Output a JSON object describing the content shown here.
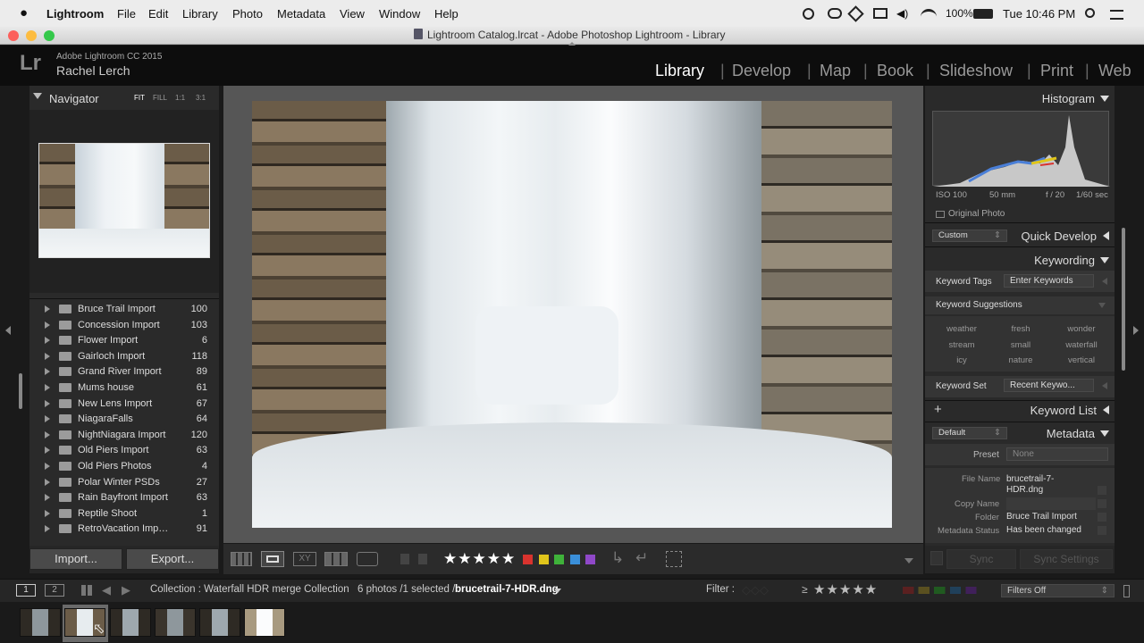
{
  "menubar": {
    "apple": "",
    "app": "Lightroom",
    "items": [
      "File",
      "Edit",
      "Library",
      "Photo",
      "Metadata",
      "View",
      "Window",
      "Help"
    ],
    "battery": "100%",
    "clock": "Tue 10:46 PM"
  },
  "window": {
    "title": "Lightroom Catalog.lrcat - Adobe Photoshop Lightroom - Library"
  },
  "identity": {
    "logo": "Lr",
    "product": "Adobe Lightroom CC 2015",
    "user": "Rachel Lerch"
  },
  "modules": [
    "Library",
    "Develop",
    "Map",
    "Book",
    "Slideshow",
    "Print",
    "Web"
  ],
  "active_module": "Library",
  "navigator": {
    "title": "Navigator",
    "zoom": [
      "FIT",
      "FILL",
      "1:1",
      "3:1"
    ]
  },
  "folders": [
    {
      "name": "Bruce Trail Import",
      "count": "100"
    },
    {
      "name": "Concession Import",
      "count": "103"
    },
    {
      "name": "Flower Import",
      "count": "6"
    },
    {
      "name": "Gairloch Import",
      "count": "118"
    },
    {
      "name": "Grand River Import",
      "count": "89"
    },
    {
      "name": "Mums house",
      "count": "61"
    },
    {
      "name": "New Lens Import",
      "count": "67"
    },
    {
      "name": "NiagaraFalls",
      "count": "64"
    },
    {
      "name": "NightNiagara Import",
      "count": "120"
    },
    {
      "name": "Old Piers Import",
      "count": "63"
    },
    {
      "name": "Old Piers Photos",
      "count": "4"
    },
    {
      "name": "Polar Winter PSDs",
      "count": "27"
    },
    {
      "name": "Rain Bayfront Import",
      "count": "63"
    },
    {
      "name": "Reptile Shoot",
      "count": "1"
    },
    {
      "name": "RetroVacation Imp…",
      "count": "91"
    }
  ],
  "left_buttons": {
    "import": "Import...",
    "export": "Export..."
  },
  "histogram": {
    "title": "Histogram",
    "iso": "ISO 100",
    "focal": "50 mm",
    "aperture": "f / 20",
    "shutter": "1/60 sec",
    "original_photo": "Original Photo"
  },
  "quick_develop": {
    "title": "Quick Develop",
    "preset": "Custom"
  },
  "keywording": {
    "title": "Keywording",
    "tags_label": "Keyword Tags",
    "tags_value": "Enter Keywords",
    "suggestions_label": "Keyword Suggestions",
    "suggestions": [
      "weather",
      "fresh",
      "wonder",
      "stream",
      "small",
      "waterfall",
      "icy",
      "nature",
      "vertical"
    ],
    "set_label": "Keyword Set",
    "set_value": "Recent Keywo..."
  },
  "keyword_list": {
    "title": "Keyword List",
    "add": "+"
  },
  "metadata": {
    "title": "Metadata",
    "view": "Default",
    "preset_label": "Preset",
    "preset_value": "None",
    "file_name_label": "File Name",
    "file_name_line1": "brucetrail-7-",
    "file_name_line2": "HDR.dng",
    "copy_name_label": "Copy Name",
    "folder_label": "Folder",
    "folder_value": "Bruce Trail Import",
    "status_label": "Metadata Status",
    "status_value": "Has been changed"
  },
  "sync": {
    "sync": "Sync",
    "sync_settings": "Sync Settings"
  },
  "toolbar": {
    "stars": "★★★★★",
    "xy": "XY"
  },
  "label_colors": [
    "#d9332e",
    "#e0c51b",
    "#3fb23a",
    "#3a8fd9",
    "#8f48c8"
  ],
  "filmbar": {
    "screen1": "1",
    "screen2": "2",
    "collection": "Collection : Waterfall HDR merge Collection",
    "count": "6 photos /1 selected /",
    "filename": "brucetrail-7-HDR.dng",
    "filter_label": "Filter :",
    "filter_op": "≥",
    "filter_stars": "★★★★★",
    "filters_off": "Filters Off"
  }
}
